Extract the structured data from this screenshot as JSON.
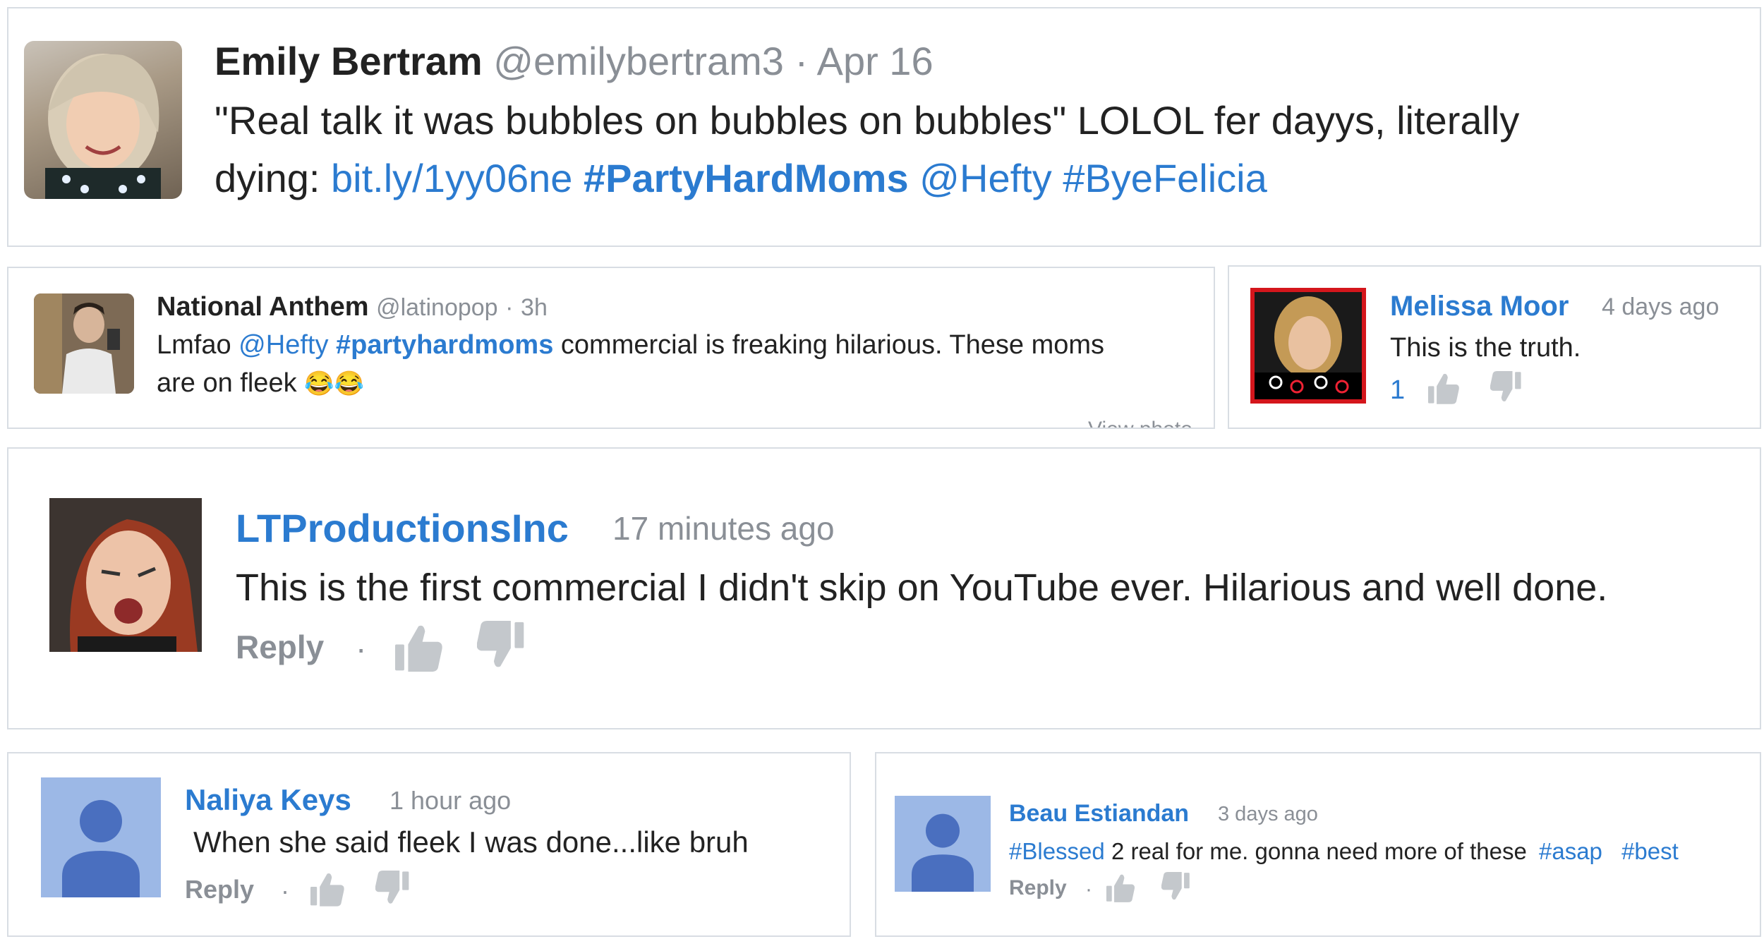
{
  "tweet1": {
    "name": "Emily Bertram",
    "handle": "@emilybertram3",
    "sep": "·",
    "date": "Apr 16",
    "line1": "\"Real talk it was bubbles on bubbles on bubbles\" LOLOL fer dayys, literally",
    "line2_prefix": "dying: ",
    "link": "bit.ly/1yy06ne",
    "hashtag1": "#PartyHardMoms",
    "mention": "@Hefty",
    "hashtag2": "#ByeFelicia"
  },
  "tweet2": {
    "name": "National Anthem",
    "handle": "@latinopop",
    "sep": "·",
    "time": "3h",
    "pre": "Lmfao ",
    "mention": "@Hefty",
    "hashtag": "#partyhardmoms",
    "post": " commercial is freaking hilarious. These moms",
    "line2": "are on fleek",
    "emoji": "😂😂",
    "footer": "View photo"
  },
  "comment_melissa": {
    "name": "Melissa Moor",
    "time": "4 days ago",
    "text": "This is the truth.",
    "likes": "1"
  },
  "comment_lt": {
    "name": "LTProductionsInc",
    "time": "17 minutes ago",
    "text": "This is the first commercial I didn't skip on YouTube ever. Hilarious and well done.",
    "reply": "Reply",
    "dot": "·"
  },
  "comment_naliya": {
    "name": "Naliya Keys",
    "time": "1 hour ago",
    "text": "When she said fleek I was done...like bruh",
    "reply": "Reply",
    "dot": "·"
  },
  "comment_beau": {
    "name": "Beau Estiandan",
    "time": "3 days ago",
    "tag1": "#Blessed",
    "text": "2 real for me. gonna need more of these",
    "tag2": "#asap",
    "tag3": "#best",
    "reply": "Reply",
    "dot": "·"
  },
  "colors": {
    "link_blue": "#2b7bd0",
    "placeholder_avatar_bg": "#9cb8e6",
    "placeholder_avatar_fg": "#4a6fbf",
    "icon_gray": "#c4c8cc"
  }
}
